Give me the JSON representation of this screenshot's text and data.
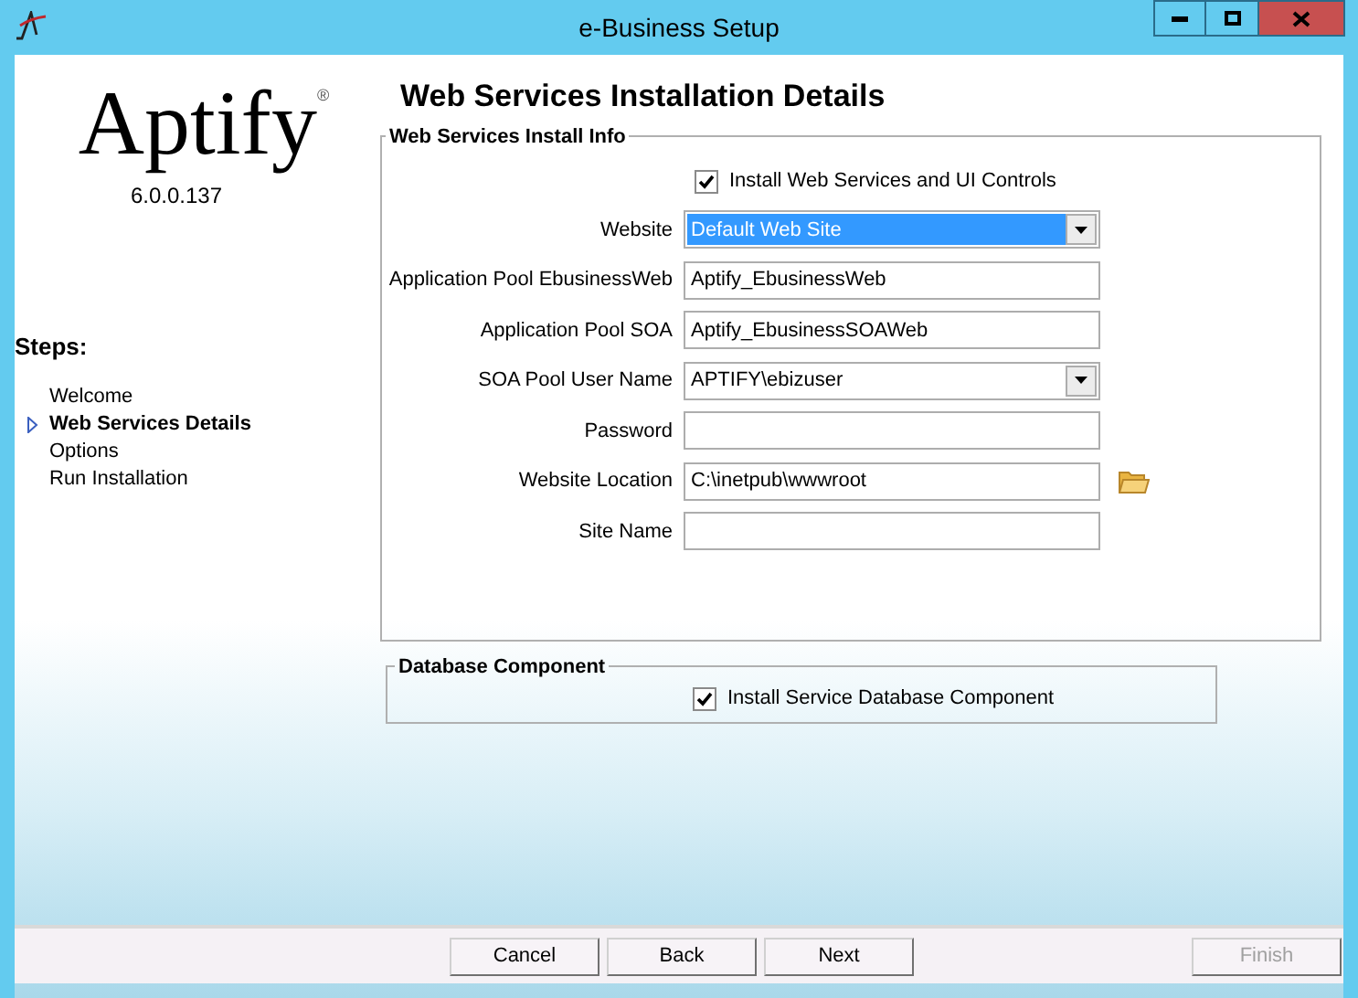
{
  "window": {
    "title": "e-Business Setup"
  },
  "logo": {
    "name": "Aptify",
    "mark": "®",
    "version": "6.0.0.137"
  },
  "steps": {
    "title": "Steps:",
    "items": [
      {
        "label": "Welcome",
        "selected": false
      },
      {
        "label": "Web Services Details",
        "selected": true
      },
      {
        "label": "Options",
        "selected": false
      },
      {
        "label": "Run Installation",
        "selected": false
      }
    ]
  },
  "heading": "Web Services Installation Details",
  "install_info": {
    "legend": "Web Services Install Info",
    "rows": [
      {
        "kind": "checkbox",
        "label": "Install Web Services and UI Controls",
        "checked": true
      },
      {
        "kind": "dropdown",
        "label": "Website",
        "value": "Default Web Site",
        "highlighted": true
      },
      {
        "kind": "text",
        "label": "Application Pool EbusinessWeb",
        "value": "Aptify_EbusinessWeb"
      },
      {
        "kind": "text",
        "label": "Application Pool SOA",
        "value": "Aptify_EbusinessSOAWeb"
      },
      {
        "kind": "dropdown",
        "label": "SOA Pool User Name",
        "value": "APTIFY\\ebizuser",
        "highlighted": false
      },
      {
        "kind": "text",
        "label": "Password"
      },
      {
        "kind": "browse",
        "label": "Website Location",
        "value": "C:\\inetpub\\wwwroot"
      },
      {
        "kind": "text",
        "label": "Site Name"
      }
    ]
  },
  "database": {
    "legend": "Database Component",
    "checkbox": {
      "label": "Install Service Database Component",
      "checked": true
    }
  },
  "buttons": [
    {
      "label": "Cancel",
      "disabled": false
    },
    {
      "label": "Back",
      "disabled": false
    },
    {
      "label": "Next",
      "disabled": false
    },
    {
      "label": "Finish",
      "disabled": true
    }
  ]
}
